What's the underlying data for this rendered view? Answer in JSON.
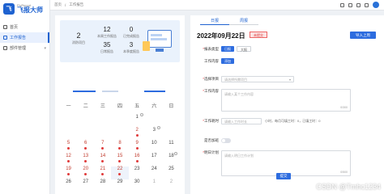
{
  "app": {
    "logo_small": "FlyReport",
    "logo_big": "飞报大师",
    "logo_mark": "飞"
  },
  "sidebar": {
    "items": [
      {
        "label": "首页",
        "active": false
      },
      {
        "label": "工作报告",
        "active": true
      },
      {
        "label": "部件管理",
        "active": false,
        "has_children": true
      }
    ]
  },
  "breadcrumb": {
    "home": "首页",
    "sep": "/",
    "current": "工作报告"
  },
  "stats": {
    "main": {
      "value": "2",
      "label": "消防项目"
    },
    "cells": [
      {
        "value": "12",
        "label": "本周工作报告"
      },
      {
        "value": "0",
        "label": "已完成报告"
      },
      {
        "value": "35",
        "label": "日常报告"
      },
      {
        "value": "3",
        "label": "本季度报告"
      }
    ]
  },
  "calendar": {
    "weekdays": [
      "一",
      "二",
      "三",
      "四",
      "五",
      "六",
      "日"
    ],
    "days": [
      {
        "d": "",
        "other": true
      },
      {
        "d": "",
        "other": true
      },
      {
        "d": "",
        "other": true
      },
      {
        "d": "",
        "other": true
      },
      {
        "d": "1",
        "mark": true
      },
      {
        "d": "",
        "other": true
      },
      {
        "d": "",
        "other": true
      },
      {
        "d": "",
        "other": true
      },
      {
        "d": "",
        "other": true
      },
      {
        "d": "",
        "other": true
      },
      {
        "d": "",
        "other": true
      },
      {
        "d": "2",
        "sel": true,
        "dot": true
      },
      {
        "d": "3",
        "mark": true
      },
      {
        "d": "",
        "other": true
      },
      {
        "d": "5",
        "sel": true,
        "dot": true
      },
      {
        "d": "6",
        "sel": true,
        "dot": true
      },
      {
        "d": "7",
        "sel": true,
        "dot": true
      },
      {
        "d": "8",
        "sel": true,
        "dot": true
      },
      {
        "d": "9",
        "sel": true,
        "dot": true
      },
      {
        "d": "10"
      },
      {
        "d": "11"
      },
      {
        "d": "12",
        "sel": true,
        "dot": true
      },
      {
        "d": "13",
        "sel": true,
        "dot": true
      },
      {
        "d": "14",
        "sel": true,
        "dot": true
      },
      {
        "d": "15",
        "sel": true,
        "dot": true
      },
      {
        "d": "16",
        "sel": true,
        "dot": true
      },
      {
        "d": "17"
      },
      {
        "d": "18",
        "mark": true
      },
      {
        "d": "19",
        "sel": true,
        "dot": true
      },
      {
        "d": "20",
        "sel": true,
        "dot": true
      },
      {
        "d": "21",
        "sel": true,
        "dot": true
      },
      {
        "d": "22",
        "sel": true,
        "dot": true,
        "today": true
      },
      {
        "d": "23"
      },
      {
        "d": "24"
      },
      {
        "d": "25"
      },
      {
        "d": "26"
      },
      {
        "d": "27"
      },
      {
        "d": "28"
      },
      {
        "d": "29"
      },
      {
        "d": "30"
      },
      {
        "d": "1",
        "other": true
      },
      {
        "d": "2",
        "other": true
      }
    ]
  },
  "report": {
    "tabs": [
      "日报",
      "周报"
    ],
    "date": "2022年09月22日",
    "status": "未提交",
    "import_label": "导入上周",
    "type_label": "报表类型",
    "type_options": [
      "日报",
      "大报"
    ],
    "content_label": "工作内容",
    "content_chip": "添加",
    "project_label": "选择项目",
    "project_placeholder": "请选择所需项目",
    "work_label": "工作内容",
    "work_placeholder": "请输入某个工作内容",
    "work_count": "0/300",
    "hours_label": "工作耗时",
    "hours_placeholder": "请输入工作时长",
    "hours_hint": "小时，每月可填工时：0，已填工时：0",
    "assist_label": "是否加班",
    "plan_label": "明日计划",
    "plan_placeholder": "请输入明日工作计划",
    "plan_count": "0/500",
    "submit_label": "提交"
  },
  "watermark": "CSDN @Tmhc1234",
  "colors": {
    "accent": "#2d6cdf",
    "status_red": "#e03a3a"
  }
}
